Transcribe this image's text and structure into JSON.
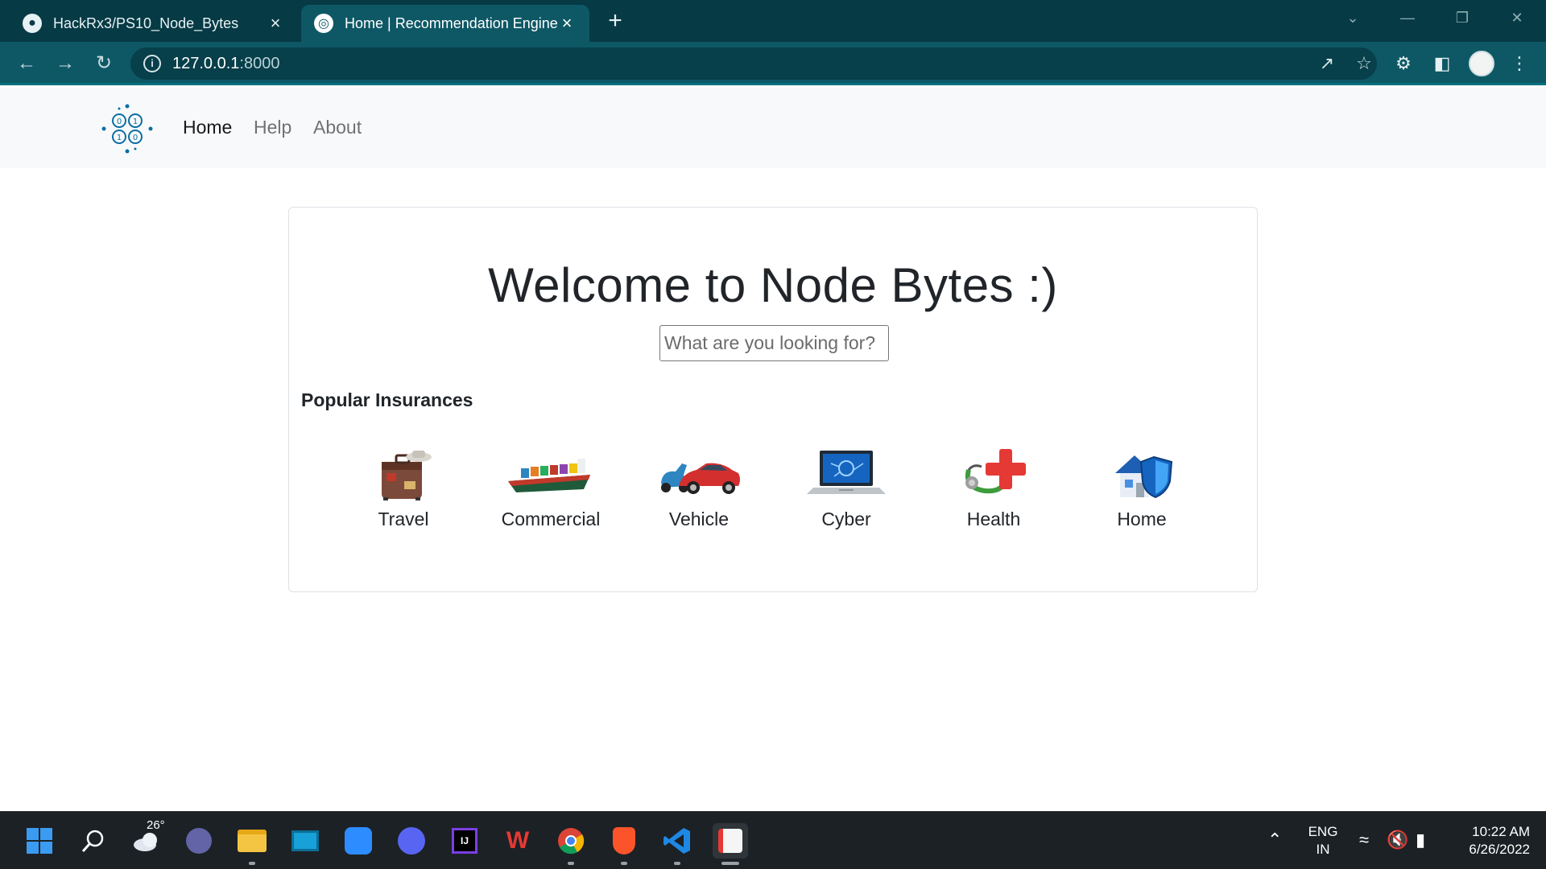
{
  "browser": {
    "tabs": [
      {
        "title": "HackRx3/PS10_Node_Bytes",
        "icon": "github-icon",
        "active": false
      },
      {
        "title": "Home | Recommendation Engine",
        "icon": "globe-icon",
        "active": true
      }
    ],
    "address": {
      "host": "127.0.0.1",
      "port": ":8000"
    }
  },
  "navbar": {
    "links": [
      {
        "label": "Home",
        "active": true
      },
      {
        "label": "Help",
        "active": false
      },
      {
        "label": "About",
        "active": false
      }
    ]
  },
  "main": {
    "heading": "Welcome to Node Bytes :)",
    "search_placeholder": "What are you looking for?",
    "section_title": "Popular Insurances",
    "insurances": [
      {
        "label": "Travel",
        "icon": "suitcase-icon"
      },
      {
        "label": "Commercial",
        "icon": "cargo-ship-icon"
      },
      {
        "label": "Vehicle",
        "icon": "car-scooter-icon"
      },
      {
        "label": "Cyber",
        "icon": "laptop-icon"
      },
      {
        "label": "Health",
        "icon": "stethoscope-cross-icon"
      },
      {
        "label": "Home",
        "icon": "house-shield-icon"
      }
    ]
  },
  "taskbar": {
    "weather": "26°",
    "lang_line1": "ENG",
    "lang_line2": "IN",
    "time": "10:22 AM",
    "date": "6/26/2022"
  },
  "colors": {
    "tabbar": "#063a45",
    "toolbar": "#0e5866",
    "brand": "#0b6fa4",
    "taskbar": "#1c2125"
  }
}
